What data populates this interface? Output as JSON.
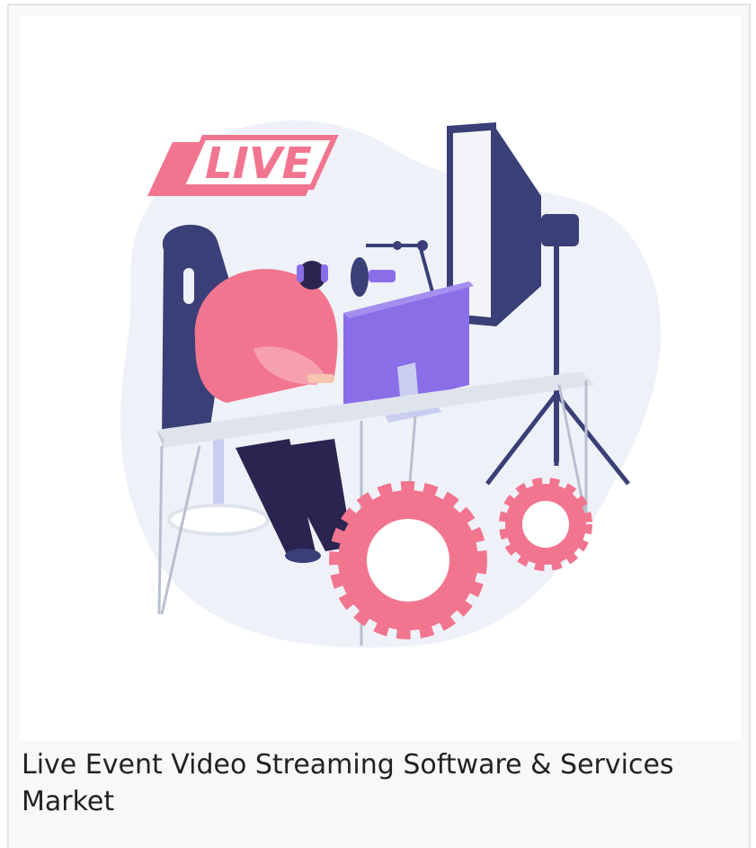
{
  "illustration": {
    "live_badge": "LIVE",
    "colors": {
      "pink": "#f2758f",
      "pink_light": "#f7a0ad",
      "navy": "#3b3f77",
      "purple": "#8a6ee8",
      "desk": "#dfe3ec",
      "blob": "#eef2f8"
    }
  },
  "card": {
    "caption": "Live Event Video Streaming Software & Services Market"
  }
}
